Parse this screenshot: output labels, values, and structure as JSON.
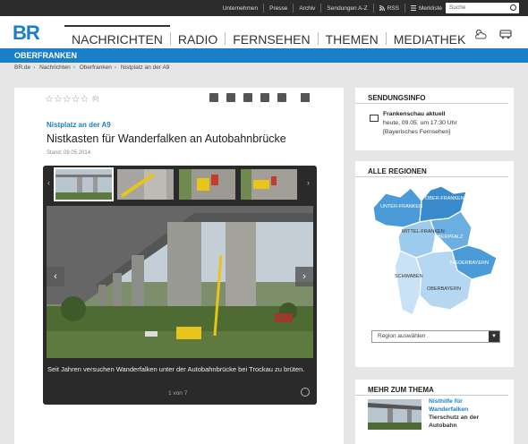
{
  "topbar": {
    "links": [
      "Unternehmen",
      "Presse",
      "Archiv",
      "Sendungen A-Z",
      "RSS",
      "Merkliste"
    ],
    "search_placeholder": "Suche"
  },
  "header": {
    "logo": "BR",
    "nav": [
      "NACHRICHTEN",
      "RADIO",
      "FERNSEHEN",
      "THEMEN",
      "MEDIATHEK"
    ]
  },
  "region_title": "OBERFRANKEN",
  "breadcrumb": [
    "BR.de",
    "Nachrichten",
    "Oberfranken",
    "Nistplatz an der A9"
  ],
  "article": {
    "rating_count": "[0]",
    "kicker": "Nistplatz an der A9",
    "title": "Nistkasten für Wanderfalken an Autobahnbrücke",
    "stand": "Stand: 09.05.2014",
    "caption": "Seit Jahren versuchen Wanderfalken unter der Autobahnbrücke bei Trockau zu brüten.",
    "pager": "1 von 7"
  },
  "sidebar": {
    "sendung": {
      "head": "SENDUNGSINFO",
      "show": "Frankenschau aktuell",
      "time": "heute, 09.05. um 17:30 Uhr",
      "channel": "[Bayerisches Fernsehen]"
    },
    "regionen": {
      "head": "ALLE REGIONEN",
      "labels": [
        "UNTER-FRANKEN",
        "OBER-FRANKEN",
        "MITTEL-FRANKEN",
        "OBERPFALZ",
        "NIEDERBAYERN",
        "SCHWABEN",
        "OBERBAYERN"
      ],
      "select": "Region auswählen"
    },
    "mehr": {
      "head": "MEHR ZUM THEMA",
      "link1": "Nisthilfe für",
      "link2": "Wanderfalken",
      "sub1": "Tierschutz an der",
      "sub2": "Autobahn"
    }
  },
  "colors": {
    "accent": "#1a7ec8",
    "topbar": "#2b2b2b"
  }
}
